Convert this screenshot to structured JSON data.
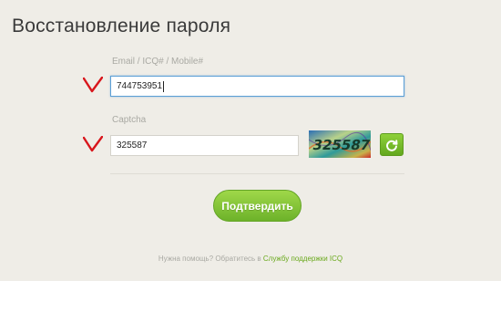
{
  "page": {
    "title": "Восстановление пароля"
  },
  "form": {
    "email_label": "Email / ICQ# / Mobile#",
    "email_value": "744753951",
    "captcha_label": "Captcha",
    "captcha_value": "325587",
    "captcha_image_text": "325587",
    "submit_label": "Подтвердить"
  },
  "help": {
    "prefix": "Нужна помощь? Обратитесь в ",
    "link_text": "Службу поддержки ICQ"
  },
  "icons": {
    "annotation_check": "red-check-mark-icon",
    "refresh": "refresh-icon"
  },
  "colors": {
    "accent_green": "#79bc2c",
    "focus_blue": "#5b9fd6",
    "annotation_red": "#d8161c",
    "background": "#efede7"
  }
}
